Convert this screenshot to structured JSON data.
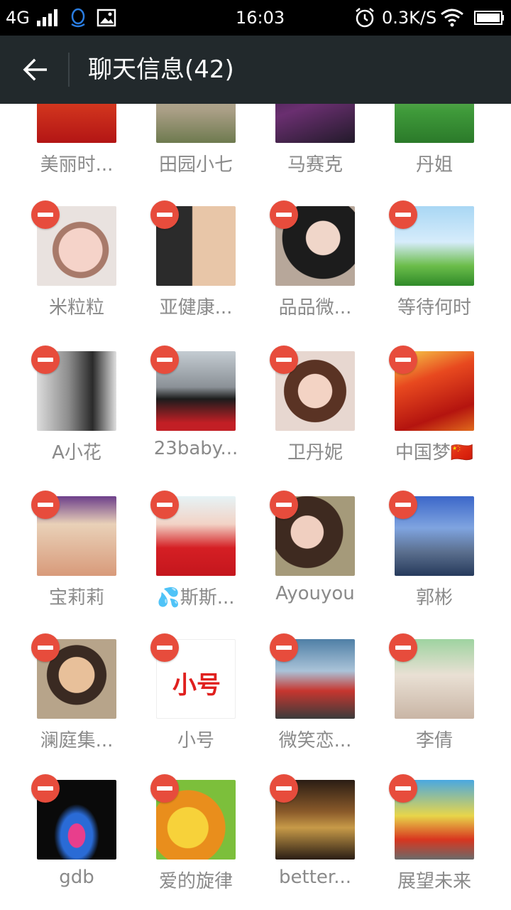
{
  "statusbar": {
    "network": "4G",
    "time": "16:03",
    "speed": "0.3K/S"
  },
  "header": {
    "title": "聊天信息(42)"
  },
  "members": [
    {
      "name": "美丽时...",
      "removable": false
    },
    {
      "name": "田园小七",
      "removable": false
    },
    {
      "name": "马赛克",
      "removable": false
    },
    {
      "name": "丹姐",
      "removable": false
    },
    {
      "name": "米粒粒",
      "removable": true
    },
    {
      "name": "亚健康...",
      "removable": true
    },
    {
      "name": "品品微...",
      "removable": true
    },
    {
      "name": "等待何时",
      "removable": true
    },
    {
      "name": "A小花",
      "removable": true
    },
    {
      "name": "23baby...",
      "removable": true
    },
    {
      "name": "卫丹妮",
      "removable": true
    },
    {
      "name": "中国梦🇨🇳",
      "removable": true
    },
    {
      "name": "宝莉莉",
      "removable": true
    },
    {
      "name": "💦斯斯...",
      "removable": true
    },
    {
      "name": "Ayouyou",
      "removable": true
    },
    {
      "name": "郭彬",
      "removable": true
    },
    {
      "name": "澜庭集...",
      "removable": true
    },
    {
      "name": "小号",
      "removable": true,
      "avatar_text": "小号"
    },
    {
      "name": "微笑恋...",
      "removable": true
    },
    {
      "name": "李倩",
      "removable": true
    },
    {
      "name": "gdb",
      "removable": true
    },
    {
      "name": "爱的旋律",
      "removable": true
    },
    {
      "name": "better...",
      "removable": true
    },
    {
      "name": "展望未来",
      "removable": true
    }
  ],
  "colors": {
    "statusbar_bg": "#000000",
    "titlebar_bg": "#22292c",
    "remove_badge": "#e74c3c",
    "name_text": "#8a8a8a"
  }
}
